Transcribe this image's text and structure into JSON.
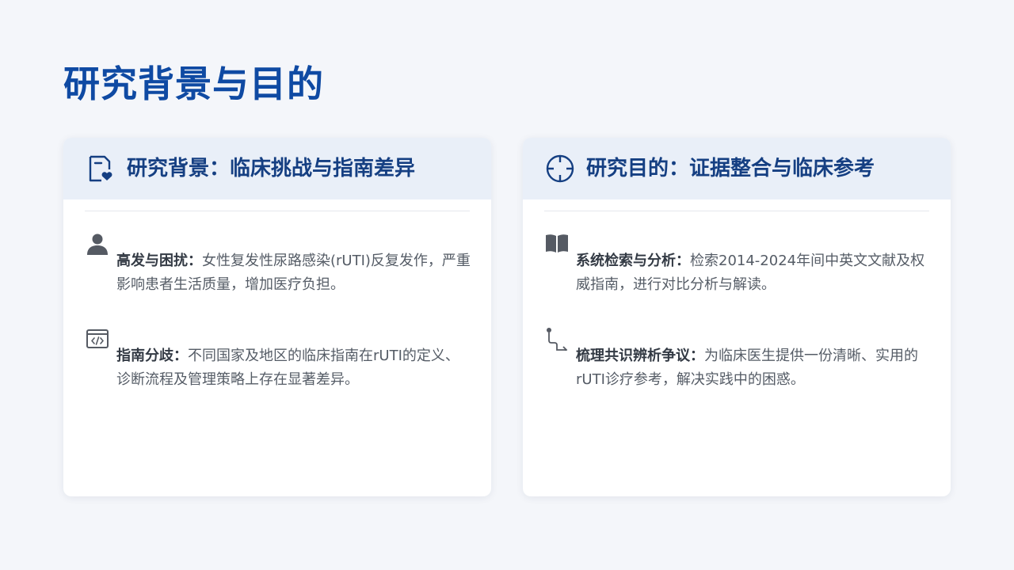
{
  "title": "研究背景与目的",
  "cards": [
    {
      "heading": "研究背景：临床挑战与指南差异",
      "icon": "document-heart-icon",
      "items": [
        {
          "icon": "person-icon",
          "label": "高发与困扰：",
          "text": "女性复发性尿路感染(rUTI)反复发作，严重影响患者生活质量，增加医疗负担。"
        },
        {
          "icon": "code-window-icon",
          "label": "指南分歧：",
          "text": "不同国家及地区的临床指南在rUTI的定义、诊断流程及管理策略上存在显著差异。"
        }
      ]
    },
    {
      "heading": "研究目的：证据整合与临床参考",
      "icon": "crosshair-icon",
      "items": [
        {
          "icon": "open-book-icon",
          "label": "系统检索与分析：",
          "text": "检索2014-2024年间中英文文献及权威指南，进行对比分析与解读。"
        },
        {
          "icon": "path-arrow-icon",
          "label": "梳理共识辨析争议：",
          "text": "为临床医生提供一份清晰、实用的rUTI诊疗参考，解决实践中的困惑。"
        }
      ]
    }
  ],
  "colors": {
    "title": "#0f4aa3",
    "heading": "#153f82",
    "header_bg": "#e9eff8",
    "icon": "#555a63"
  }
}
